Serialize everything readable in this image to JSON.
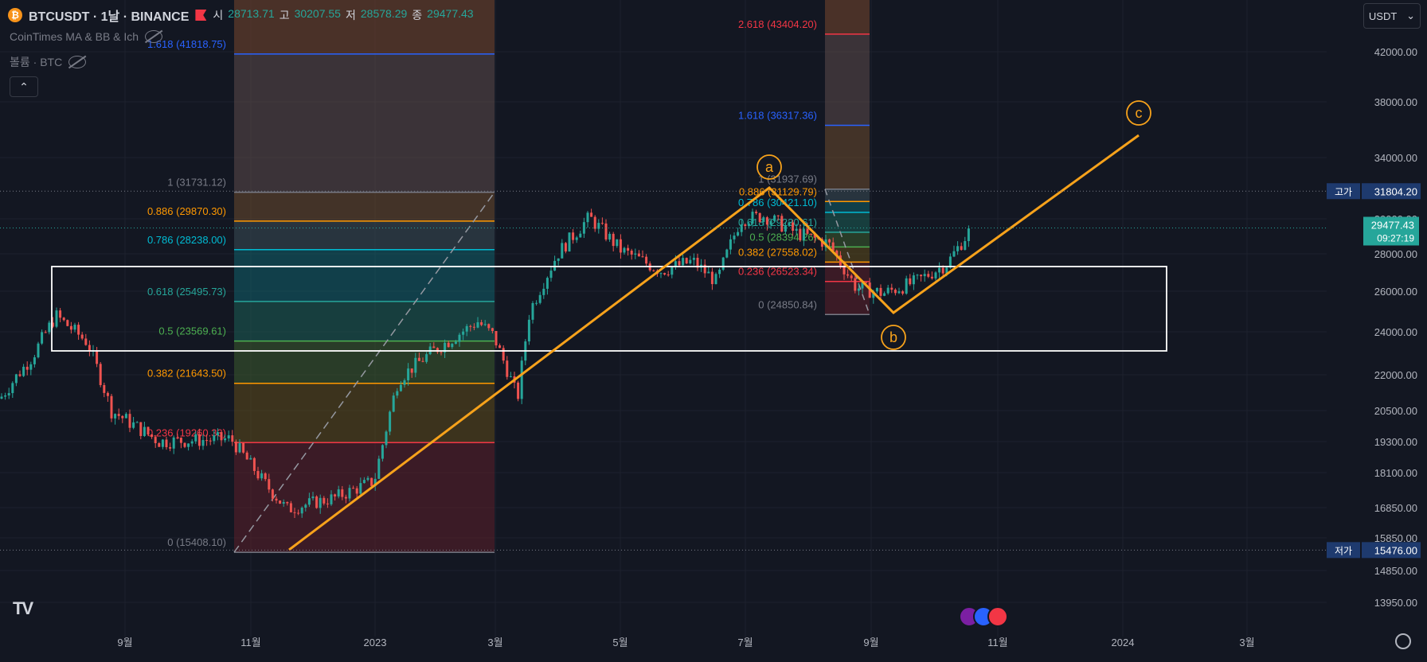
{
  "header": {
    "symbol": "BTCUSDT · 1날 · BINANCE",
    "coin_icon": "bitcoin-icon",
    "ohlc": [
      {
        "key": "시",
        "value": "28713.71"
      },
      {
        "key": "고",
        "value": "30207.55"
      },
      {
        "key": "저",
        "value": "28578.29"
      },
      {
        "key": "종",
        "value": "29477.43"
      }
    ],
    "indicators": [
      "CoinTimes MA & BB & Ich",
      "볼륨 · BTC"
    ],
    "collapse_icon": "chevron-up-icon"
  },
  "currency": "USDT",
  "chart_data": {
    "type": "candlestick",
    "price_axis": [
      "42000.00",
      "38000.00",
      "34000.00",
      "30000.00",
      "28000.00",
      "26000.00",
      "24000.00",
      "22000.00",
      "20500.00",
      "19300.00",
      "18100.00",
      "16850.00",
      "15850.00",
      "14850.00",
      "13950.00"
    ],
    "time_axis": [
      "9월",
      "11월",
      "2023",
      "3월",
      "5월",
      "7월",
      "9월",
      "11월",
      "2024",
      "3월"
    ],
    "high_marker": {
      "label": "고가",
      "value": "31804.20"
    },
    "low_marker": {
      "label": "저가",
      "value": "15476.00"
    },
    "last_price": {
      "value": "29477.43",
      "countdown": "09:27:19"
    },
    "fib_left": {
      "levels": [
        {
          "ratio": "1.618",
          "value": "41818.75",
          "color": "#2962ff"
        },
        {
          "ratio": "1",
          "value": "31731.12",
          "color": "#787b86"
        },
        {
          "ratio": "0.886",
          "value": "29870.30",
          "color": "#ff9800"
        },
        {
          "ratio": "0.786",
          "value": "28238.00",
          "color": "#00bcd4"
        },
        {
          "ratio": "0.618",
          "value": "25495.73",
          "color": "#26a69a"
        },
        {
          "ratio": "0.5",
          "value": "23569.61",
          "color": "#4caf50"
        },
        {
          "ratio": "0.382",
          "value": "21643.50",
          "color": "#ff9800"
        },
        {
          "ratio": "0.236",
          "value": "19260.33",
          "color": "#f23645"
        },
        {
          "ratio": "0",
          "value": "15408.10",
          "color": "#787b86"
        }
      ]
    },
    "fib_right": {
      "levels": [
        {
          "ratio": "2.618",
          "value": "43404.20",
          "color": "#f23645"
        },
        {
          "ratio": "1.618",
          "value": "36317.36",
          "color": "#2962ff"
        },
        {
          "ratio": "1",
          "value": "31937.69",
          "color": "#787b86"
        },
        {
          "ratio": "0.886",
          "value": "31129.79",
          "color": "#ff9800"
        },
        {
          "ratio": "0.786",
          "value": "30421.10",
          "color": "#00bcd4"
        },
        {
          "ratio": "0.618",
          "value": "29230.61",
          "color": "#26a69a"
        },
        {
          "ratio": "0.5",
          "value": "28394.26",
          "color": "#4caf50"
        },
        {
          "ratio": "0.382",
          "value": "27558.02",
          "color": "#ff9800"
        },
        {
          "ratio": "0.236",
          "value": "26523.34",
          "color": "#f23645"
        },
        {
          "ratio": "0",
          "value": "24850.84",
          "color": "#787b86"
        }
      ]
    },
    "wave_labels": [
      "a",
      "b",
      "c"
    ],
    "colors": {
      "up": "#26a69a",
      "down": "#ef5350",
      "wave": "#f7a21b",
      "box": "#ffffff"
    }
  },
  "footer": {
    "logo": "TV",
    "settings_icon": "gear-icon"
  }
}
